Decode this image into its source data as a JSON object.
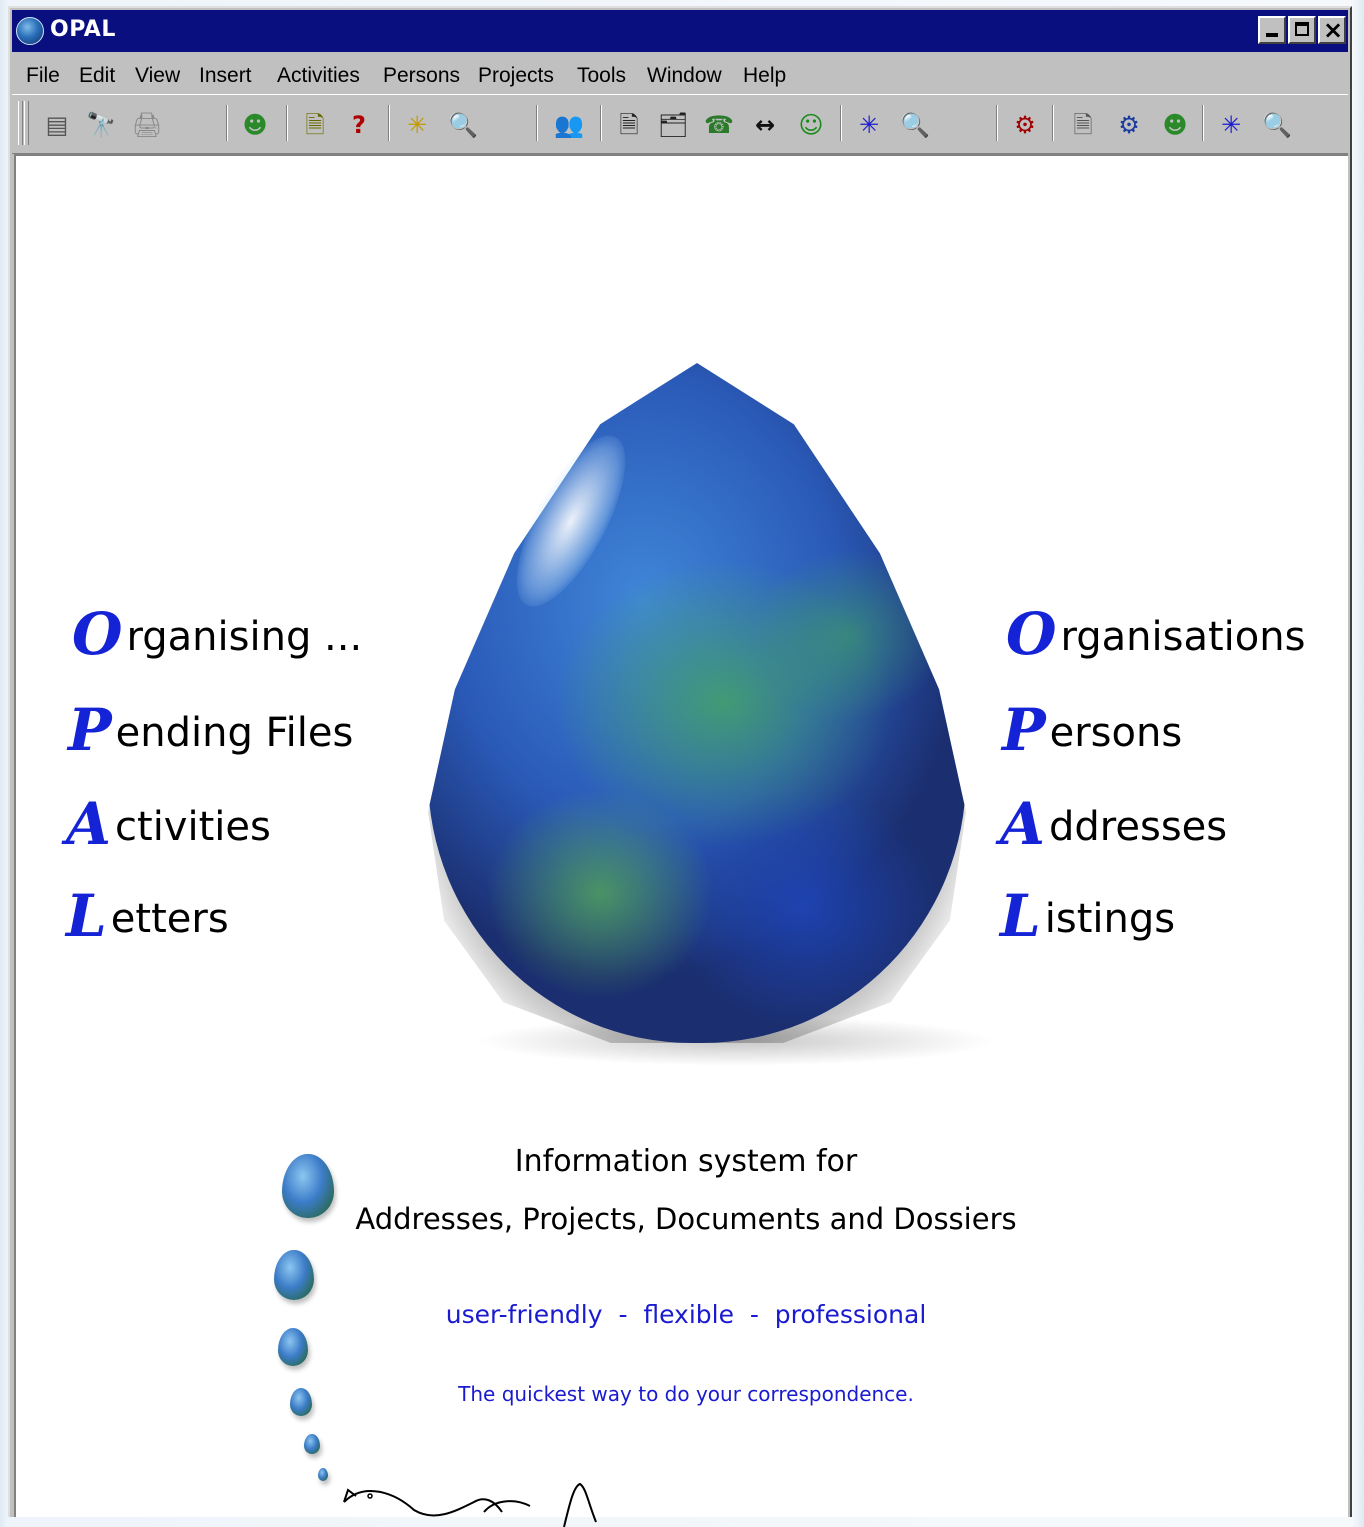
{
  "window": {
    "title": "OPAL",
    "app_icon": "opal-app-icon",
    "controls": {
      "minimize": "minimize-icon",
      "maximize": "maximize-icon",
      "close": "close-icon"
    }
  },
  "menu": {
    "items": [
      "File",
      "Edit",
      "View",
      "Insert",
      "Activities",
      "Persons",
      "Projects",
      "Tools",
      "Window",
      "Help"
    ]
  },
  "toolbar": {
    "tools": [
      {
        "name": "list-view-icon",
        "glyph": "▤"
      },
      {
        "name": "binoculars-search-icon",
        "glyph": "🔭"
      },
      {
        "name": "print-icon",
        "glyph": "🖨"
      },
      {
        "name": "smiley-person-icon",
        "glyph": "☻"
      },
      {
        "name": "person-document-icon",
        "glyph": "🗎"
      },
      {
        "name": "help-person-icon",
        "glyph": "?"
      },
      {
        "name": "new-smiley-icon",
        "glyph": "✳"
      },
      {
        "name": "document-search-icon",
        "glyph": "🔍"
      },
      {
        "name": "persons-group-icon",
        "glyph": "👥"
      },
      {
        "name": "person-document-icon-2",
        "glyph": "🗎"
      },
      {
        "name": "person-card-icon",
        "glyph": "🗂"
      },
      {
        "name": "person-phone-icon",
        "glyph": "☎"
      },
      {
        "name": "persons-link-icon",
        "glyph": "↔"
      },
      {
        "name": "person-smiley-icon",
        "glyph": "☺"
      },
      {
        "name": "new-person-icon",
        "glyph": "✳"
      },
      {
        "name": "person-search-icon",
        "glyph": "🔍"
      },
      {
        "name": "project-link-icon",
        "glyph": "⚙"
      },
      {
        "name": "project-document-icon",
        "glyph": "🗎"
      },
      {
        "name": "project-gears-icon",
        "glyph": "⚙"
      },
      {
        "name": "project-smiley-icon",
        "glyph": "☻"
      },
      {
        "name": "new-project-icon",
        "glyph": "✳"
      },
      {
        "name": "project-search-icon",
        "glyph": "🔍"
      }
    ]
  },
  "splash": {
    "left_acronym": [
      {
        "cap": "O",
        "rest": "rganising ..."
      },
      {
        "cap": "P",
        "rest": "ending Files"
      },
      {
        "cap": "A",
        "rest": "ctivities"
      },
      {
        "cap": "L",
        "rest": "etters"
      }
    ],
    "right_acronym": [
      {
        "cap": "O",
        "rest": "rganisations"
      },
      {
        "cap": "P",
        "rest": "ersons"
      },
      {
        "cap": "A",
        "rest": "ddresses"
      },
      {
        "cap": "L",
        "rest": "istings"
      }
    ],
    "info_line1": "Information system for",
    "info_line2": "Addresses, Projects, Documents and Dossiers",
    "tagline": "user-friendly  -  flexible  -  professional",
    "quickest": "The quickest way to do your correspondence.",
    "colors": {
      "accent_blue": "#1523d6",
      "tagline_blue": "#1a1acf",
      "titlebar": "#0a0f80"
    }
  }
}
